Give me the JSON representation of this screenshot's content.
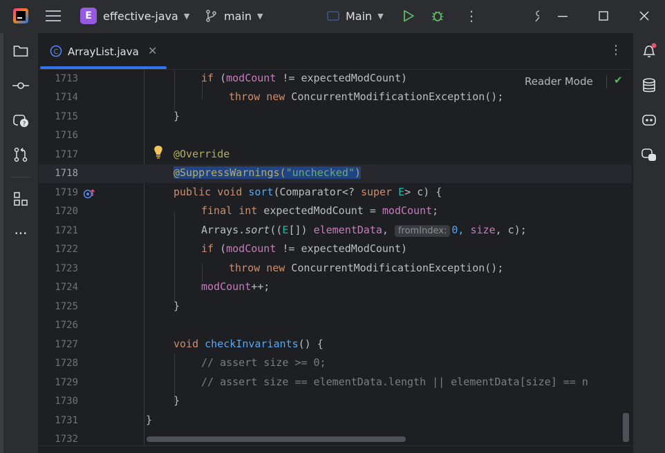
{
  "titlebar": {
    "project_name": "effective-java",
    "project_badge": "E",
    "branch": "main",
    "run_config": "Main"
  },
  "tabs": [
    {
      "label": "ArrayList.java",
      "icon": "class-c-icon"
    }
  ],
  "editor": {
    "reader_mode_label": "Reader Mode",
    "lines": [
      {
        "num": "1713"
      },
      {
        "num": "1714"
      },
      {
        "num": "1715"
      },
      {
        "num": "1716"
      },
      {
        "num": "1717"
      },
      {
        "num": "1718"
      },
      {
        "num": "1719"
      },
      {
        "num": "1720"
      },
      {
        "num": "1721"
      },
      {
        "num": "1722"
      },
      {
        "num": "1723"
      },
      {
        "num": "1724"
      },
      {
        "num": "1725"
      },
      {
        "num": "1726"
      },
      {
        "num": "1727"
      },
      {
        "num": "1728"
      },
      {
        "num": "1729"
      },
      {
        "num": "1730"
      },
      {
        "num": "1731"
      },
      {
        "num": "1732"
      }
    ],
    "inlay_hint": "fromIndex:",
    "code": {
      "l1713_if": "if",
      "l1713_open": " (",
      "l1713_field": "modCount",
      "l1713_rest": " != expectedModCount)",
      "l1714_throw": "throw",
      "l1714_new": "new",
      "l1714_rest": " ConcurrentModificationException();",
      "brace_close": "}",
      "l1717_override": "@Override",
      "l1718_suppress": "@SuppressWarnings(",
      "l1718_str": "\"unchecked\"",
      "l1718_close": ")",
      "l1719_public": "public",
      "l1719_void": "void",
      "l1719_sort": "sort",
      "l1719_paren": "(Comparator<? ",
      "l1719_super": "super",
      "l1719_E": "E",
      "l1719_rest": "> c) {",
      "l1720_final": "final",
      "l1720_int": "int",
      "l1720_mid": " expectedModCount = ",
      "l1720_field": "modCount",
      "l1720_end": ";",
      "l1721_arrays": "Arrays.",
      "l1721_sort": "sort",
      "l1721_cast": "((",
      "l1721_E": "E",
      "l1721_cast2": "[]) ",
      "l1721_elem": "elementData",
      "l1721_comma": ", ",
      "l1721_zero": "0, ",
      "l1721_size": "size",
      "l1721_end": ", c);",
      "l1724_field": "modCount",
      "l1724_end": "++;",
      "l1727_void": "void",
      "l1727_name": "checkInvariants",
      "l1727_end": "() {",
      "l1728_comment": "// assert size >= 0;",
      "l1729_comment": "// assert size == elementData.length || elementData[size] == n",
      "outer_close": "}"
    }
  },
  "colors": {
    "accent": "#3574f0",
    "keyword": "#cf8e6d",
    "field": "#c77dbb",
    "string": "#6aab73",
    "annotation": "#b3ae60",
    "function": "#56a8f5",
    "selection": "#214283"
  }
}
